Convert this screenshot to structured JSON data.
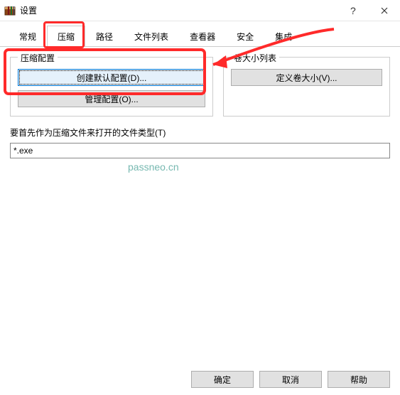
{
  "window": {
    "title": "设置"
  },
  "tabs": {
    "general": "常规",
    "compress": "压缩",
    "path": "路径",
    "filelist": "文件列表",
    "viewer": "查看器",
    "security": "安全",
    "integration": "集成"
  },
  "compress_group": {
    "title": "压缩配置",
    "create_default": "创建默认配置(D)...",
    "manage": "管理配置(O)..."
  },
  "volume_group": {
    "title": "卷大小列表",
    "define": "定义卷大小(V)..."
  },
  "open_as_archive": {
    "label": "要首先作为压缩文件来打开的文件类型(T)",
    "value": "*.exe"
  },
  "footer": {
    "ok": "确定",
    "cancel": "取消",
    "help": "帮助"
  },
  "watermark": "passneo.cn"
}
